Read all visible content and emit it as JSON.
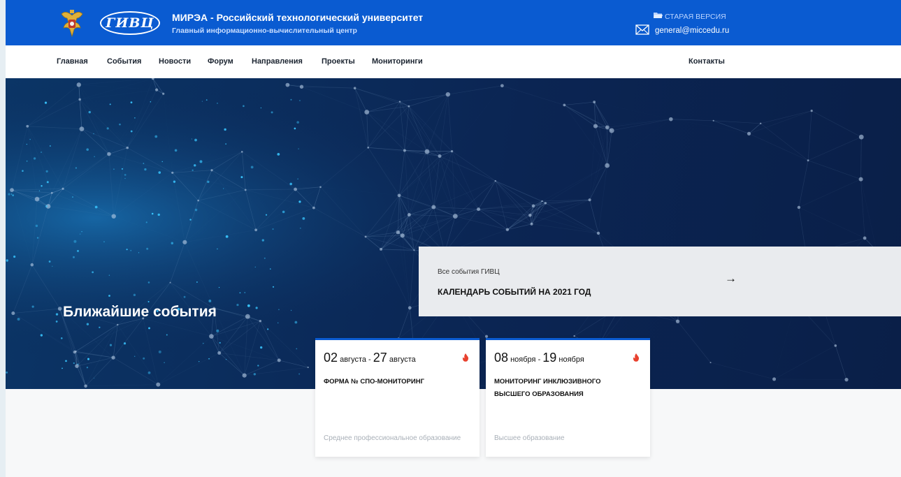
{
  "header": {
    "logo_text": "ГИВЦ",
    "org_title": "МИРЭА - Российский технологический университет",
    "org_subtitle": "Главный информационно-вычислительный центр",
    "old_version_label": "СТАРАЯ ВЕРСИЯ",
    "email": "general@miccedu.ru"
  },
  "nav": {
    "items": [
      "Главная",
      "События",
      "Новости",
      "Форум",
      "Направления",
      "Проекты",
      "Мониторинги"
    ],
    "contacts": "Контакты"
  },
  "hero": {
    "title": "Ближайшие события",
    "calendar_card": {
      "kicker": "Все события ГИВЦ",
      "title": "КАЛЕНДАРЬ СОБЫТИЙ НА 2021 ГОД",
      "arrow": "→"
    }
  },
  "events": [
    {
      "start_day": "02",
      "start_month": "августа",
      "separator": "-",
      "end_day": "27",
      "end_month": "августа",
      "name": "ФОРМА № СПО-МОНИТОРИНГ",
      "category": "Среднее профессиональное образование"
    },
    {
      "start_day": "08",
      "start_month": "ноября",
      "separator": "-",
      "end_day": "19",
      "end_month": "ноября",
      "name": "МОНИТОРИНГ ИНКЛЮЗИВНОГО ВЫСШЕГО ОБРАЗОВАНИЯ",
      "category": "Высшее образование"
    }
  ],
  "colors": {
    "brand_blue": "#0a5bd1",
    "hero_navy": "#0b2553",
    "fire_red": "#e8412e"
  }
}
